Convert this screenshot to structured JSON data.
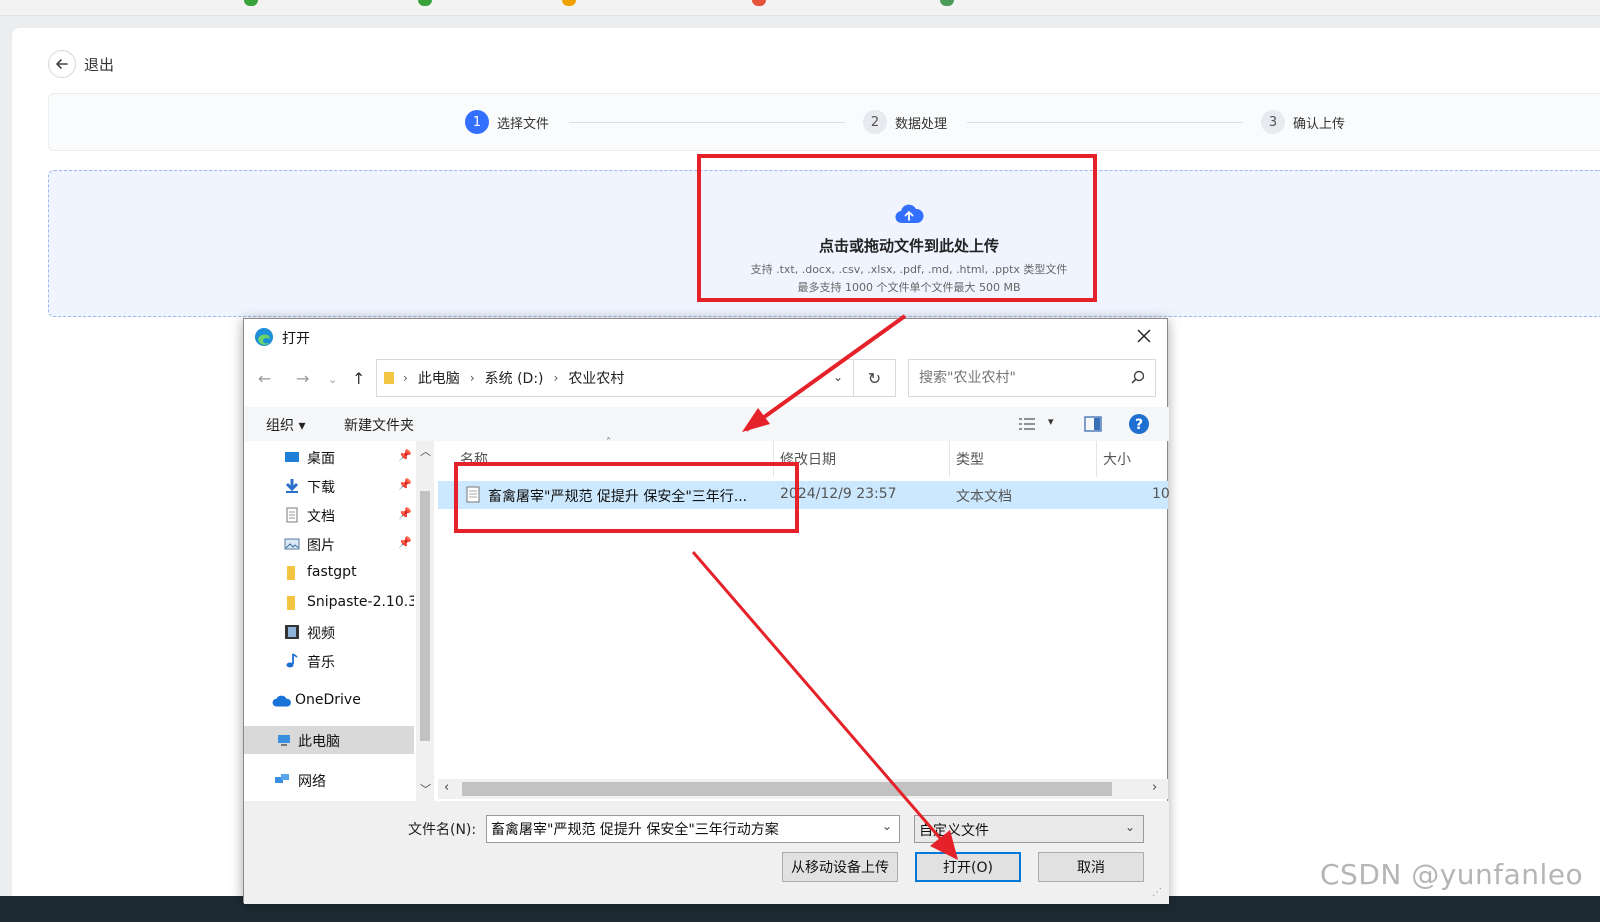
{
  "page": {
    "back_label": "退出",
    "steps": [
      {
        "num": "1",
        "label": "选择文件"
      },
      {
        "num": "2",
        "label": "数据处理"
      },
      {
        "num": "3",
        "label": "确认上传"
      }
    ],
    "dropzone": {
      "title": "点击或拖动文件到此处上传",
      "supported": "支持 .txt, .docx, .csv, .xlsx, .pdf, .md, .html, .pptx 类型文件",
      "limits": "最多支持 1000 个文件单个文件最大 500 MB"
    }
  },
  "dialog": {
    "title": "打开",
    "breadcrumbs": [
      "此电脑",
      "系统 (D:)",
      "农业农村"
    ],
    "search_placeholder": "搜索\"农业农村\"",
    "toolbar": {
      "organize": "组织 ▾",
      "new_folder": "新建文件夹"
    },
    "nav_items": [
      {
        "label": "桌面",
        "pinned": true,
        "icon": "desktop-icon"
      },
      {
        "label": "下载",
        "pinned": true,
        "icon": "download-icon"
      },
      {
        "label": "文档",
        "pinned": true,
        "icon": "document-icon"
      },
      {
        "label": "图片",
        "pinned": true,
        "icon": "picture-icon"
      },
      {
        "label": "fastgpt",
        "pinned": false,
        "icon": "folder-icon"
      },
      {
        "label": "Snipaste-2.10.3",
        "pinned": false,
        "icon": "folder-icon"
      },
      {
        "label": "视频",
        "pinned": false,
        "icon": "video-icon"
      },
      {
        "label": "音乐",
        "pinned": false,
        "icon": "music-icon"
      },
      {
        "label": "OneDrive",
        "pinned": false,
        "icon": "cloud-icon"
      },
      {
        "label": "此电脑",
        "pinned": false,
        "icon": "computer-icon"
      },
      {
        "label": "网络",
        "pinned": false,
        "icon": "network-icon"
      }
    ],
    "columns": [
      "名称",
      "修改日期",
      "类型",
      "大小"
    ],
    "files": [
      {
        "name": "畜禽屠宰\"严规范 促提升 保安全\"三年行...",
        "date": "2024/12/9 23:57",
        "type": "文本文档",
        "size": "10"
      }
    ],
    "filename_label": "文件名(N):",
    "filename_value": "畜禽屠宰\"严规范 促提升 保安全\"三年行动方案",
    "filetype": "自定义文件",
    "buttons": {
      "mobile": "从移动设备上传",
      "open": "打开(O)",
      "cancel": "取消"
    }
  },
  "watermark": "CSDN @yunfanleo",
  "colors": {
    "accent": "#3370ff",
    "annotation": "#e5222a",
    "selection": "#cce8ff"
  }
}
